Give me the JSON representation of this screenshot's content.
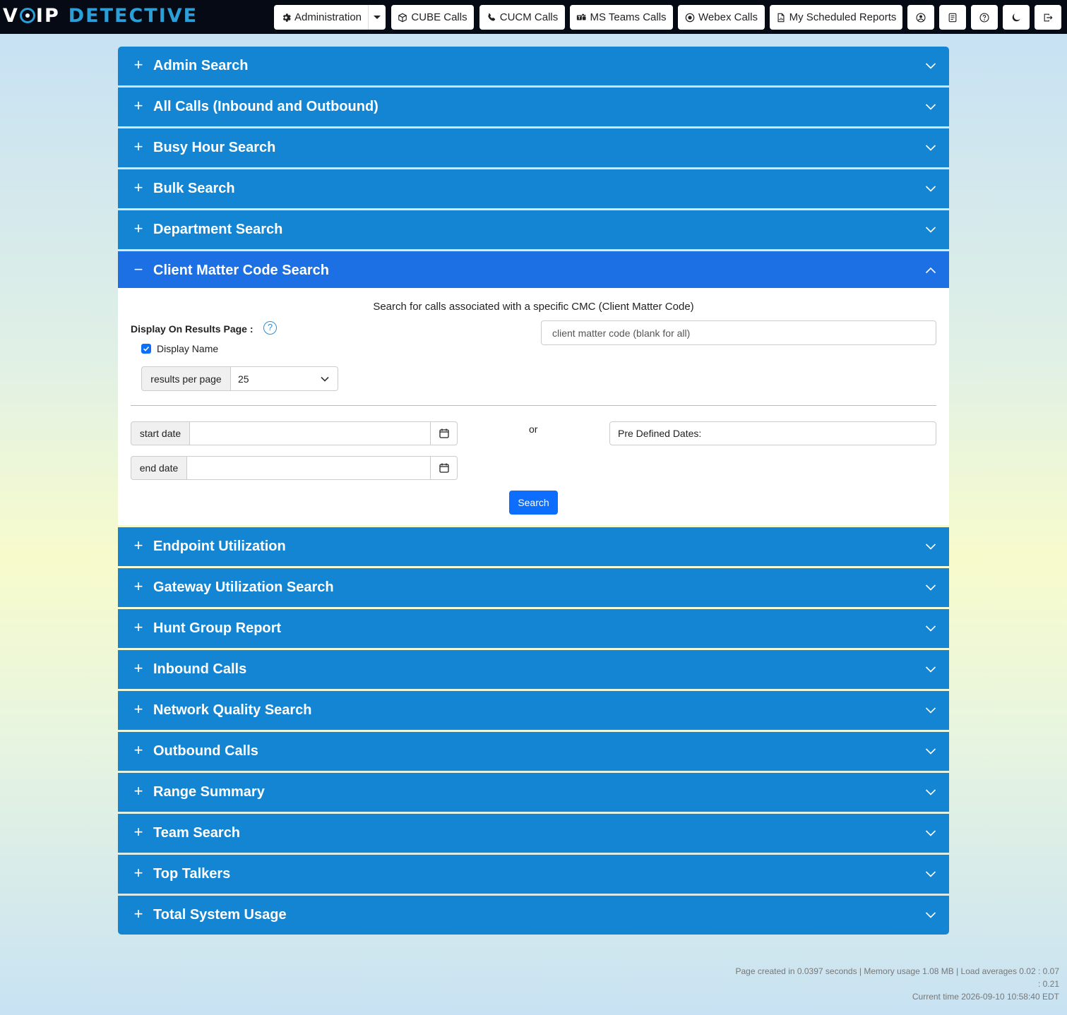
{
  "navbar": {
    "logo_part1": "V",
    "logo_part2": "IP",
    "logo_part3": "DETECTIVE",
    "buttons": {
      "administration": "Administration",
      "cube": "CUBE Calls",
      "cucm": "CUCM Calls",
      "teams": "MS Teams Calls",
      "webex": "Webex Calls",
      "reports": "My Scheduled Reports"
    }
  },
  "accordion": {
    "sections": [
      "Admin Search",
      "All Calls (Inbound and Outbound)",
      "Busy Hour Search",
      "Bulk Search",
      "Department Search",
      "Client Matter Code Search",
      "Endpoint Utilization",
      "Gateway Utilization Search",
      "Hunt Group Report",
      "Inbound Calls",
      "Network Quality Search",
      "Outbound Calls",
      "Range Summary",
      "Team Search",
      "Top Talkers",
      "Total System Usage"
    ],
    "active_index": 5
  },
  "cmc_panel": {
    "description": "Search for calls associated with a specific CMC (Client Matter Code)",
    "display_label": "Display On Results Page :",
    "help": "?",
    "checkbox_label": "Display Name",
    "checkbox_checked": true,
    "results_label": "results per page",
    "results_value": "25",
    "cmc_placeholder": "client matter code (blank for all)",
    "start_label": "start date",
    "end_label": "end date",
    "or_text": "or",
    "predefined_label": "Pre Defined Dates:",
    "search_button": "Search"
  },
  "footer": {
    "line1": "Page created in 0.0397 seconds | Memory usage 1.08 MB | Load averages 0.02 : 0.07",
    "line2": ": 0.21",
    "line3": "Current time 2026-09-10 10:58:40 EDT"
  },
  "colors": {
    "navbar": "#050a14",
    "accordion_header": "#1385d3",
    "accordion_active": "#1d6fe4",
    "primary_button": "#0d6efd"
  },
  "icons": {
    "administration": "gear-icon",
    "cube": "cube-icon",
    "cucm": "phone-icon",
    "teams": "teams-icon",
    "webex": "webex-icon",
    "reports": "report-icon",
    "user": "user-circle-icon",
    "notes": "notes-icon",
    "help": "help-circle-icon",
    "theme": "moon-icon",
    "logout": "logout-icon"
  }
}
